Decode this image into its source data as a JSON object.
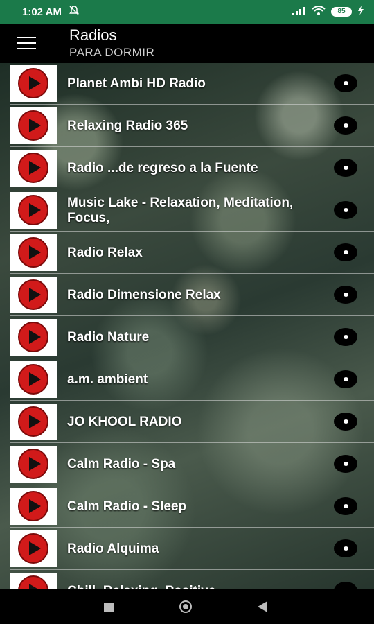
{
  "status_bar": {
    "time": "1:02 AM",
    "mute_icon": "bell-slash-icon",
    "signal_icon": "signal-icon",
    "wifi_icon": "wifi-icon",
    "battery": "85",
    "charging_icon": "bolt-icon"
  },
  "app_bar": {
    "menu_icon": "hamburger-menu-icon",
    "title": "Radios",
    "subtitle": "PARA DORMIR"
  },
  "stations": [
    {
      "name": "Planet Ambi HD Radio"
    },
    {
      "name": "Relaxing Radio 365"
    },
    {
      "name": "Radio ...de regreso a la Fuente"
    },
    {
      "name": "Music Lake - Relaxation, Meditation, Focus,"
    },
    {
      "name": "Radio Relax"
    },
    {
      "name": "Radio Dimensione Relax"
    },
    {
      "name": "Radio Nature"
    },
    {
      "name": "a.m. ambient"
    },
    {
      "name": "JO KHOOL RADIO"
    },
    {
      "name": "Calm Radio - Spa"
    },
    {
      "name": "Calm Radio - Sleep"
    },
    {
      "name": "Radio Alquima"
    },
    {
      "name": "Chill, Relaxing, Positive"
    }
  ],
  "icons": {
    "thumbnail": "play-button-icon",
    "row_menu": "more-options-icon"
  },
  "colors": {
    "status_bar": "#1b7a4a",
    "play_red": "#d11a1a"
  },
  "nav_bar": {
    "recents_icon": "square-icon",
    "home_icon": "home-circle-icon",
    "back_icon": "back-triangle-icon"
  }
}
